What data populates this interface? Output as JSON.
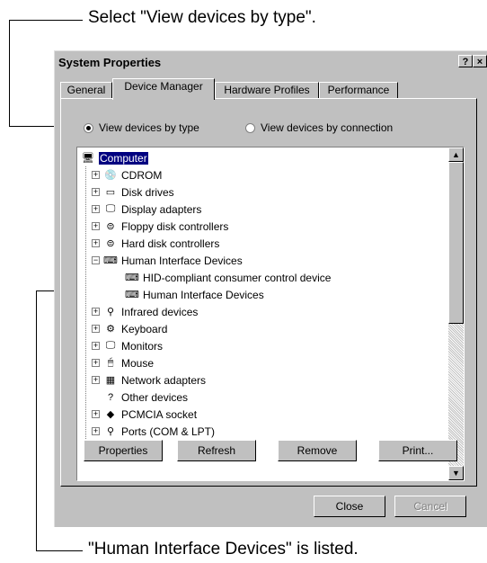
{
  "annotations": {
    "top": "Select \"View devices by type\".",
    "bottom": "\"Human Interface Devices\" is listed."
  },
  "dialog": {
    "title": "System Properties",
    "help_button": "?",
    "close_button": "×",
    "tabs": [
      "General",
      "Device Manager",
      "Hardware Profiles",
      "Performance"
    ],
    "active_tab": "Device Manager",
    "radio_by_type": "View devices by type",
    "radio_by_connection": "View devices by connection",
    "selected_view": "by_type"
  },
  "tree": {
    "items": [
      {
        "label": "Computer",
        "icon": "computer-icon",
        "level": 0,
        "expander": "",
        "selected": true
      },
      {
        "label": "CDROM",
        "icon": "cdrom-icon",
        "level": 1,
        "expander": "+"
      },
      {
        "label": "Disk drives",
        "icon": "disk-drive-icon",
        "level": 1,
        "expander": "+"
      },
      {
        "label": "Display adapters",
        "icon": "monitor-icon",
        "level": 1,
        "expander": "+"
      },
      {
        "label": "Floppy disk controllers",
        "icon": "controller-icon",
        "level": 1,
        "expander": "+"
      },
      {
        "label": "Hard disk controllers",
        "icon": "controller-icon",
        "level": 1,
        "expander": "+"
      },
      {
        "label": "Human Interface Devices",
        "icon": "hid-icon",
        "level": 1,
        "expander": "−"
      },
      {
        "label": "HID-compliant consumer control device",
        "icon": "hid-icon",
        "level": 2,
        "expander": ""
      },
      {
        "label": "Human Interface Devices",
        "icon": "hid-icon",
        "level": 2,
        "expander": ""
      },
      {
        "label": "Infrared devices",
        "icon": "infrared-icon",
        "level": 1,
        "expander": "+"
      },
      {
        "label": "Keyboard",
        "icon": "keyboard-icon",
        "level": 1,
        "expander": "+"
      },
      {
        "label": "Monitors",
        "icon": "monitor-icon",
        "level": 1,
        "expander": "+"
      },
      {
        "label": "Mouse",
        "icon": "mouse-icon",
        "level": 1,
        "expander": "+"
      },
      {
        "label": "Network adapters",
        "icon": "network-icon",
        "level": 1,
        "expander": "+"
      },
      {
        "label": "Other devices",
        "icon": "question-icon",
        "level": 1,
        "expander": ""
      },
      {
        "label": "PCMCIA socket",
        "icon": "pcmcia-icon",
        "level": 1,
        "expander": "+"
      },
      {
        "label": "Ports (COM & LPT)",
        "icon": "port-icon",
        "level": 1,
        "expander": "+"
      }
    ]
  },
  "buttons": {
    "properties": "Properties",
    "refresh": "Refresh",
    "remove": "Remove",
    "print": "Print...",
    "close": "Close",
    "cancel": "Cancel"
  },
  "colors": {
    "selection": "#000080",
    "face": "#c0c0c0"
  }
}
